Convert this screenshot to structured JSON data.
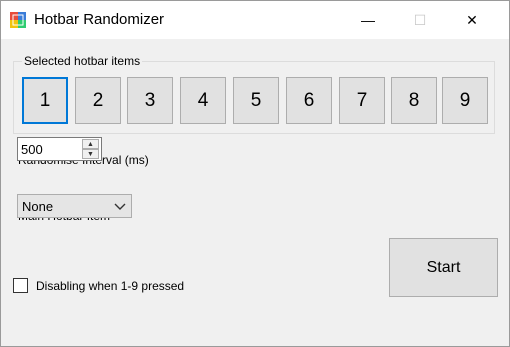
{
  "window": {
    "title": "Hotbar Randomizer",
    "controls": {
      "minimize": "—",
      "maximize": "☐",
      "close": "✕"
    },
    "icon": "app-colored-squares-icon"
  },
  "hotbar_group": {
    "legend": "Selected hotbar items",
    "items": [
      {
        "label": "1",
        "selected": true
      },
      {
        "label": "2",
        "selected": false
      },
      {
        "label": "3",
        "selected": false
      },
      {
        "label": "4",
        "selected": false
      },
      {
        "label": "5",
        "selected": false
      },
      {
        "label": "6",
        "selected": false
      },
      {
        "label": "7",
        "selected": false
      },
      {
        "label": "8",
        "selected": false
      },
      {
        "label": "9",
        "selected": false
      }
    ]
  },
  "interval": {
    "label": "Randomise Interval (ms)",
    "value": "500"
  },
  "main_item": {
    "label": "Main Hotbar Item",
    "selected": "None"
  },
  "disable_checkbox": {
    "label": "Disabling when 1-9 pressed",
    "checked": false
  },
  "start_button": {
    "label": "Start"
  },
  "colors": {
    "accent": "#0078d7",
    "button_bg": "#e1e1e1",
    "window_bg": "#f0f0f0"
  }
}
